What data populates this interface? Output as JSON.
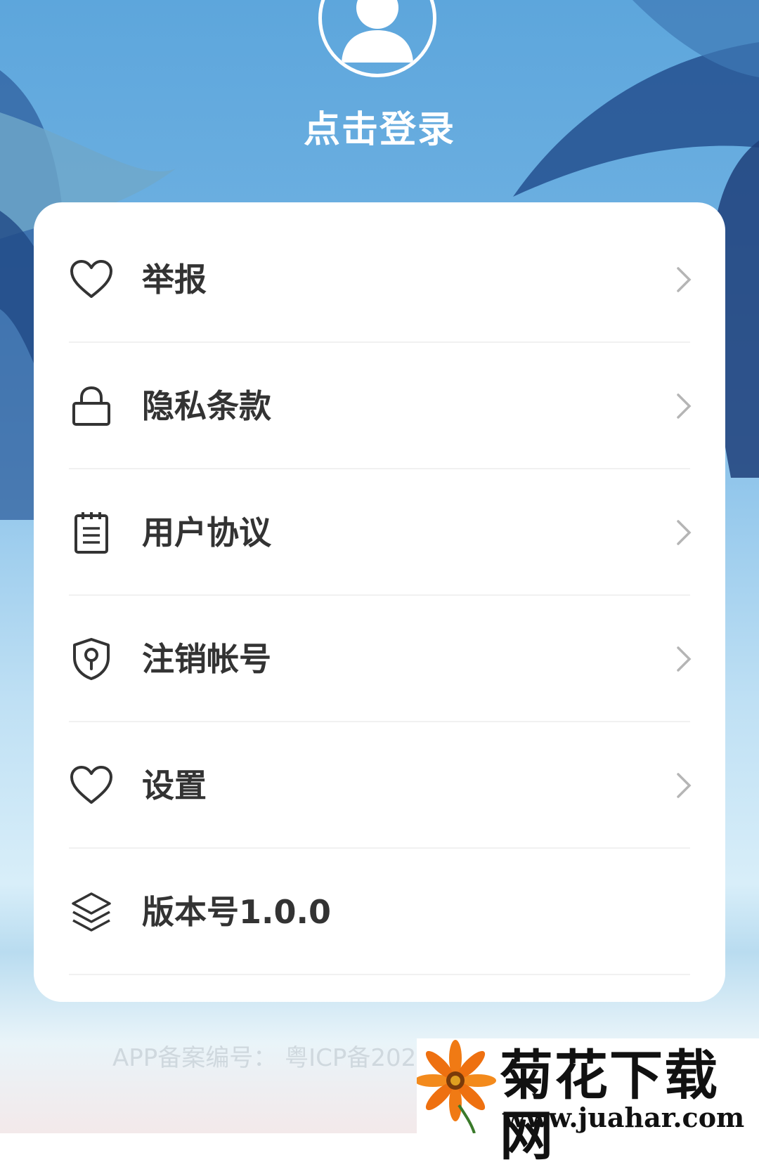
{
  "header": {
    "login_label": "点击登录"
  },
  "menu": {
    "items": [
      {
        "label": "举报",
        "icon": "heart-icon"
      },
      {
        "label": "隐私条款",
        "icon": "lock-icon"
      },
      {
        "label": "用户协议",
        "icon": "notepad-icon"
      },
      {
        "label": "注销帐号",
        "icon": "shield-key-icon"
      },
      {
        "label": "设置",
        "icon": "heart-icon"
      },
      {
        "label": "版本号1.0.0",
        "icon": "layers-icon"
      }
    ]
  },
  "footer": {
    "record_text": "APP备案编号：  粤ICP备202"
  },
  "watermark": {
    "title": "菊花下载网",
    "url": "www.juahar.com"
  },
  "colors": {
    "sky": "#5da6dc",
    "card": "#ffffff",
    "text": "#333333",
    "chevron": "#b5b5b5"
  }
}
